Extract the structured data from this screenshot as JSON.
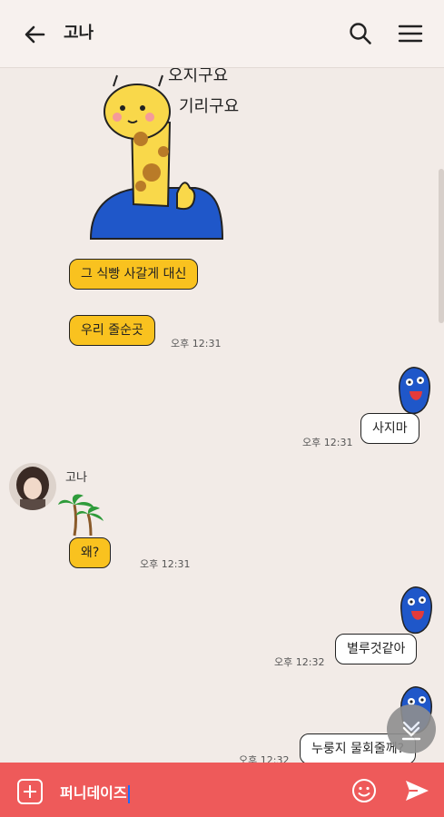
{
  "header": {
    "title": "고나"
  },
  "sticker_text": {
    "line1": "오지구요",
    "line2": "기리구요"
  },
  "messages": {
    "m1": {
      "text": "그 식빵 사갈게 대신"
    },
    "m2": {
      "text": "우리 줄순곳",
      "time": "오후 12:31"
    },
    "m3": {
      "text": "사지마",
      "time": "오후 12:31"
    },
    "sender_name": "고나",
    "m4": {
      "text": "왜?",
      "time": "오후 12:31"
    },
    "m5": {
      "text": "별루것같아",
      "time": "오후 12:32"
    },
    "m6": {
      "text": "누룽지 물회줄께?",
      "time": "오후 12:32"
    }
  },
  "composer": {
    "value": "퍼니데이즈"
  },
  "colors": {
    "accent": "#ee5a5a",
    "bubble_yellow": "#f9c21f",
    "background": "#f2ebe7"
  },
  "icons": [
    "back-arrow-icon",
    "search-icon",
    "menu-icon",
    "scroll-down-icon",
    "add-icon",
    "emoji-icon",
    "send-icon"
  ]
}
